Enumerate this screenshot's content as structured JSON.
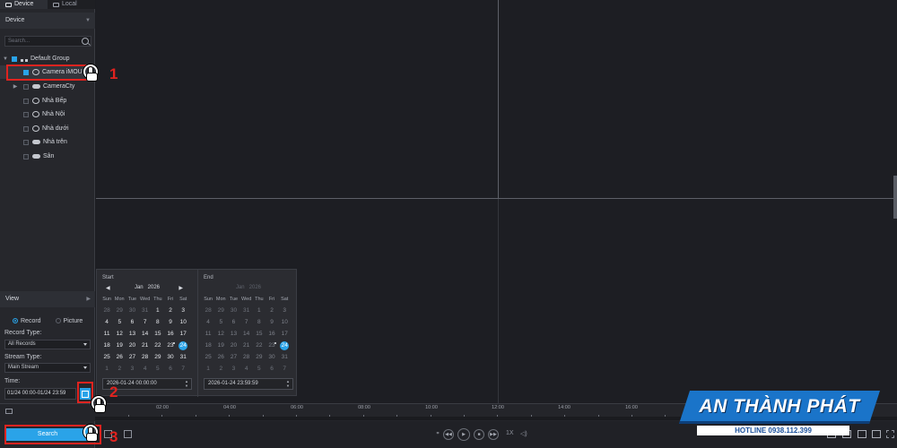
{
  "tabs": [
    {
      "label": "Device"
    },
    {
      "label": "Local"
    }
  ],
  "device_panel": {
    "title": "Device",
    "search_placeholder": "Search...",
    "group_label": "Default Group",
    "items": [
      {
        "label": "Camera iMOU"
      },
      {
        "label": "CameraCty"
      },
      {
        "label": "Nhà Bếp"
      },
      {
        "label": "Nhà Nội"
      },
      {
        "label": "Nhà dưới"
      },
      {
        "label": "Nhà trên"
      },
      {
        "label": "Sân"
      }
    ]
  },
  "view_panel": {
    "title": "View",
    "mode_record": "Record",
    "mode_picture": "Picture",
    "record_type_label": "Record Type:",
    "record_type_value": "All Records",
    "stream_type_label": "Stream Type:",
    "stream_type_value": "Main Stream",
    "time_label": "Time:",
    "time_value": "01/24 00:00-01/24 23:59",
    "search_button": "Search"
  },
  "calendar": {
    "start_label": "Start",
    "end_label": "End",
    "month": "Jan",
    "year": "2026",
    "weekdays": [
      "Sun",
      "Mon",
      "Tue",
      "Wed",
      "Thu",
      "Fri",
      "Sat"
    ],
    "start_input": "2026-01-24 00:00:00",
    "end_input": "2026-01-24 23:59:59",
    "selected_day": "24"
  },
  "timeline_ticks": [
    "02:00",
    "04:00",
    "06:00",
    "08:00",
    "10:00",
    "12:00",
    "14:00",
    "16:00"
  ],
  "playback": {
    "speed": "1X"
  },
  "steps": [
    "1",
    "2",
    "3"
  ],
  "brand": {
    "name": "AN THÀNH PHÁT",
    "hotline": "HOTLINE 0938.112.399"
  },
  "colors": {
    "accent": "#2aa3e8",
    "highlight": "#e0231f",
    "background": "#1c1d22",
    "brand": "#1a74c9"
  }
}
